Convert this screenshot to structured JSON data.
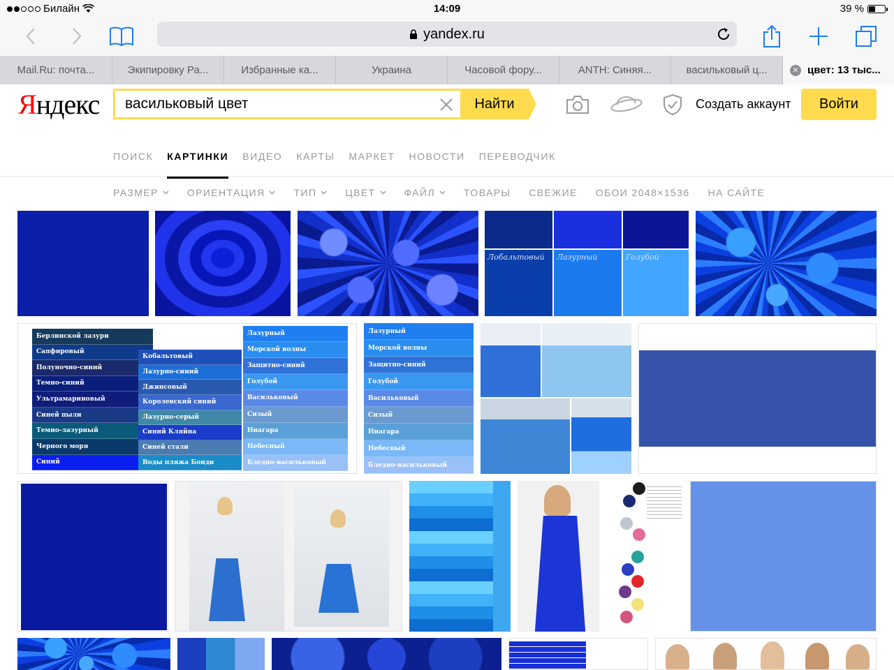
{
  "status_bar": {
    "carrier": "Билайн",
    "time": "14:09",
    "battery": "39 %",
    "battery_level": 0.39
  },
  "browser": {
    "url": "yandex.ru",
    "icons": {
      "back": "chevron-left-icon",
      "forward": "chevron-right-icon",
      "bookmarks": "book-icon",
      "lock": "lock-icon",
      "reload": "reload-icon",
      "share": "share-icon",
      "new_tab": "plus-icon",
      "tabs": "tabs-icon"
    },
    "accent_color": "#1a7cf5"
  },
  "tabs": [
    {
      "title": "Mail.Ru: почта...",
      "active": false
    },
    {
      "title": "Экипировку Ра...",
      "active": false
    },
    {
      "title": "Избранные ка...",
      "active": false
    },
    {
      "title": "Украина",
      "active": false
    },
    {
      "title": "Часовой фору...",
      "active": false
    },
    {
      "title": "ANTH: Синяя...",
      "active": false
    },
    {
      "title": "васильковый ц...",
      "active": false
    },
    {
      "title": "цвет: 13 тыс...",
      "active": true
    }
  ],
  "header": {
    "logo_first": "Я",
    "logo_rest": "ндекс",
    "search_value": "васильковый цвет",
    "search_button": "Найти",
    "create_account": "Создать аккаунт",
    "login_button": "Войти",
    "brand_color": "#ffdb4d",
    "icons": [
      "camera-icon",
      "saturn-icon",
      "shield-check-icon"
    ]
  },
  "services": [
    {
      "label": "ПОИСК",
      "active": false
    },
    {
      "label": "КАРТИНКИ",
      "active": true
    },
    {
      "label": "ВИДЕО",
      "active": false
    },
    {
      "label": "КАРТЫ",
      "active": false
    },
    {
      "label": "МАРКЕТ",
      "active": false
    },
    {
      "label": "НОВОСТИ",
      "active": false
    },
    {
      "label": "ПЕРЕВОДЧИК",
      "active": false
    }
  ],
  "filters": [
    {
      "label": "РАЗМЕР",
      "dropdown": true
    },
    {
      "label": "ОРИЕНТАЦИЯ",
      "dropdown": true
    },
    {
      "label": "ТИП",
      "dropdown": true
    },
    {
      "label": "ЦВЕТ",
      "dropdown": true
    },
    {
      "label": "ФАЙЛ",
      "dropdown": true
    },
    {
      "label": "ТОВАРЫ",
      "dropdown": false
    },
    {
      "label": "СВЕЖИЕ",
      "dropdown": false
    },
    {
      "label": "ОБОИ 2048×1536",
      "dropdown": false
    },
    {
      "label": "НА САЙТЕ",
      "dropdown": false
    }
  ],
  "results": {
    "cobalt_labels": [
      "Лобальтовый",
      "Лазурный",
      "Голубой"
    ],
    "palette_big": {
      "col1": [
        "Берлинской лазури",
        "Сапфировый",
        "Полуночно-синий",
        "Темно-синий",
        "Ультрамариновый",
        "Синей пыли",
        "Темно-лазурный",
        "Черного моря",
        "Синий"
      ],
      "col2": [
        "Кобальтовый",
        "Лазурно-синий",
        "Джинсовый",
        "Королевский синий",
        "Лазурно-серый",
        "Синий Кляйна",
        "Синей стали",
        "Воды пляжа Бонди"
      ],
      "col3": [
        "Лазурный",
        "Морской волны",
        "Защитно-синий",
        "Голубой",
        "Васильковый",
        "Сизый",
        "Ниагара",
        "Небесный",
        "Бледно-васильковый"
      ]
    },
    "palette_small": [
      "Лазурный",
      "Морской волны",
      "Защитно-синий",
      "Голубой",
      "Васильковый",
      "Сизый",
      "Ниагара",
      "Небесный",
      "Бледно-васильковый"
    ],
    "colors": {
      "dark_blue": "#0c1fa8",
      "royal_blue": "#3553a8",
      "cornflower": "#6592e8",
      "navy": "#0a1aa0"
    }
  }
}
